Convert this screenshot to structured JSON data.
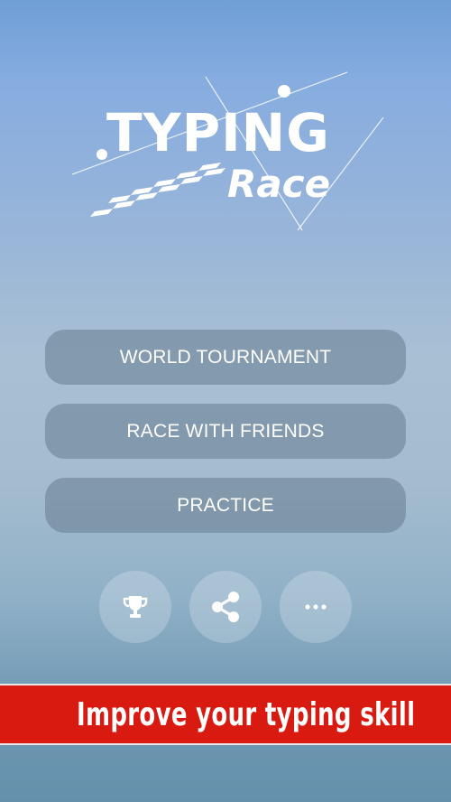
{
  "logo": {
    "word1": "TYPING",
    "word2": "Race"
  },
  "menu": {
    "items": [
      {
        "label": "WORLD TOURNAMENT"
      },
      {
        "label": "RACE WITH FRIENDS"
      },
      {
        "label": "PRACTICE"
      }
    ]
  },
  "icons": [
    "trophy-icon",
    "share-icon",
    "more-icon"
  ],
  "banner": {
    "text": "Improve your typing skill",
    "color": "#d91a10"
  }
}
